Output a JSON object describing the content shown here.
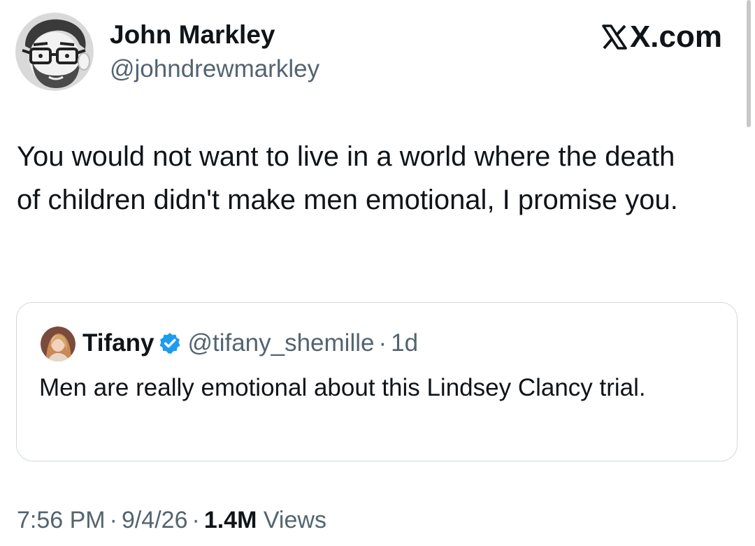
{
  "author": {
    "name": "John Markley",
    "handle": "@johndrewmarkley",
    "avatar_icon": "cartoon-man-glasses-beard-avatar"
  },
  "brand": {
    "label": "X.com",
    "icon": "x-logo-icon"
  },
  "tweet": {
    "text": "You would not want to live in a world where the death of children didn't make men emotional,  I promise you."
  },
  "quoted_tweet": {
    "name": "Tifany",
    "verified": true,
    "verified_icon": "verified-badge-icon",
    "handle": "@tifany_shemille",
    "separator": "·",
    "age": "1d",
    "text": "Men are really emotional about this Lindsey Clancy trial.",
    "avatar_icon": "woman-photo-avatar"
  },
  "meta": {
    "time": "7:56 PM",
    "date": "9/4/26",
    "views_count": "1.4M",
    "views_label": "Views",
    "separator": "·"
  },
  "colors": {
    "text_primary": "#0f1419",
    "text_secondary": "#536471",
    "border": "#cfd9de",
    "verified_blue": "#1d9bf0"
  }
}
